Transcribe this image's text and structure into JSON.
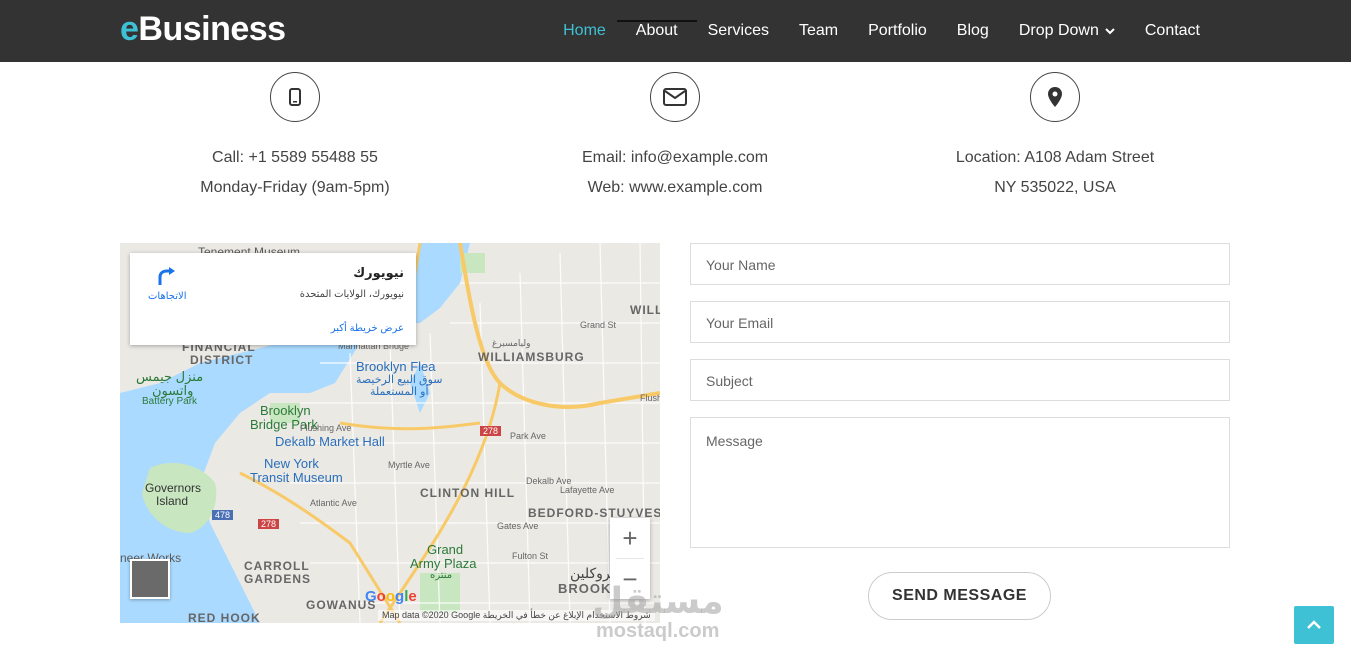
{
  "brand": {
    "prefix": "e",
    "rest": "Business"
  },
  "nav": {
    "items": [
      {
        "label": "Home",
        "active": true
      },
      {
        "label": "About"
      },
      {
        "label": "Services"
      },
      {
        "label": "Team"
      },
      {
        "label": "Portfolio"
      },
      {
        "label": "Blog"
      },
      {
        "label": "Drop Down",
        "dropdown": true
      },
      {
        "label": "Contact"
      }
    ]
  },
  "contact": {
    "phone": {
      "icon": "mobile-phone-icon",
      "line1": "Call: +1 5589 55488 55",
      "line2": "Monday-Friday (9am-5pm)"
    },
    "email": {
      "icon": "envelope-icon",
      "line1": "Email: info@example.com",
      "line2": "Web: www.example.com"
    },
    "location": {
      "icon": "map-marker-icon",
      "line1": "Location: A108 Adam Street",
      "line2": "NY 535022, USA"
    }
  },
  "map": {
    "card": {
      "title": "نيويورك",
      "address": "نيويورك، الولايات المتحدة",
      "bigger_map": "عرض خريطة أكبر",
      "directions": "الاتجاهات"
    },
    "labels": {
      "tenement": "Tenement Museum",
      "financial": "FINANCIAL",
      "district": "DISTRICT",
      "manhattan_bridge": "Manhattan Bridge",
      "brooklyn_flea": "Brooklyn Flea",
      "flea_ar1": "سوق البيع الرخيصة",
      "flea_ar2": "أو المستعملة",
      "williamsburg": "WILLIAMSBURG",
      "williamsburg_ar": "وليامسبرغ",
      "willi": "WILLI",
      "manzel": "منزل جيمس",
      "watson": "واتسون",
      "battery": "Battery Park",
      "brooklyn_bridge_park1": "Brooklyn",
      "brooklyn_bridge_park2": "Bridge Park",
      "dekalb_hall": "Dekalb Market Hall",
      "ny_transit1": "New York",
      "ny_transit2": "Transit Museum",
      "governors1": "Governors",
      "governors2": "Island",
      "clinton_hill": "CLINTON HILL",
      "bedford": "BEDFORD-STUYVES",
      "grand_army1": "Grand",
      "grand_army2": "Army Plaza",
      "grand_army_ar": "منتزه",
      "carroll1": "CARROLL",
      "carroll2": "GARDENS",
      "gowanus": "GOWANUS",
      "red_hook": "RED HOOK",
      "brooklyn_ar": "بروكلين",
      "brook": "BROOK",
      "works": "neer Works",
      "shield_278a": "278",
      "shield_278b": "278",
      "shield_478": "478",
      "park_ave": "Park Ave",
      "myrtle": "Myrtle Ave",
      "dekalb_ave": "Dekalb Ave",
      "lafayette": "Lafayette Ave",
      "gates": "Gates Ave",
      "fulton": "Fulton St",
      "flushing": "Flushing Ave",
      "flushing2": "Flushing Ave",
      "grand_st": "Grand St",
      "atlantic": "Atlantic Ave"
    },
    "google": "Google",
    "footer": "Map data ©2020 Google    شروط الاستخدام    الإبلاغ عن خطأ في الخريطة",
    "zoom_in": "+",
    "zoom_out": "−"
  },
  "form": {
    "name_placeholder": "Your Name",
    "email_placeholder": "Your Email",
    "subject_placeholder": "Subject",
    "message_placeholder": "Message",
    "send_label": "SEND MESSAGE"
  },
  "watermark": {
    "arabic": "مستقل",
    "latin": "mostaql.com"
  },
  "colors": {
    "accent": "#3ec1d5",
    "navbar": "#333333"
  }
}
